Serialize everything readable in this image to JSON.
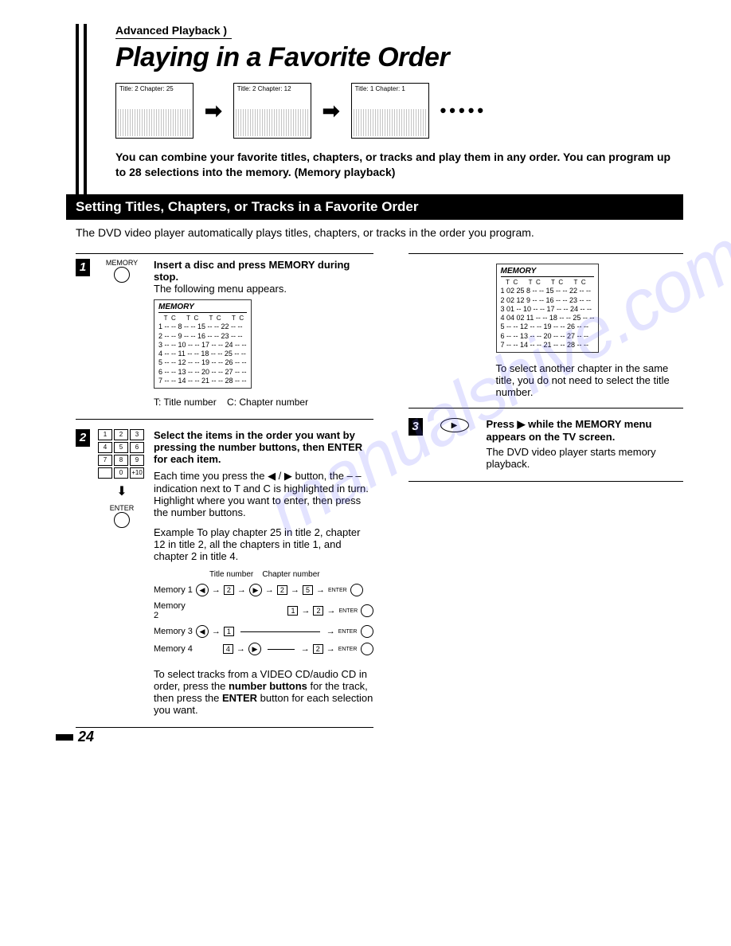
{
  "breadcrumb": "Advanced Playback",
  "title": "Playing in a Favorite Order",
  "cards": {
    "c1": "Title: 2\nChapter: 25",
    "c2": "Title: 2\nChapter: 12",
    "c3": "Title: 1\nChapter: 1"
  },
  "intro": "You can combine your favorite titles, chapters, or tracks and play them in any order. You can program up to 28 selections into the memory. (Memory playback)",
  "section_bar": "Setting Titles, Chapters, or Tracks in a Favorite Order",
  "subtext": "The DVD video player automatically plays titles, chapters, or tracks in the order you program.",
  "step1": {
    "icon_label": "MEMORY",
    "heading": "Insert a disc and press MEMORY during stop.",
    "sub": "The following menu appears.",
    "table_title": "MEMORY",
    "head": "T  C",
    "rows": [
      "1 -- --   8 -- --  15 -- --  22 -- --",
      "2 -- --   9 -- --  16 -- --  23 -- --",
      "3 -- --  10 -- --  17 -- --  24 -- --",
      "4 -- --  11 -- --  18 -- --  25 -- --",
      "5 -- --  12 -- --  19 -- --  26 -- --",
      "6 -- --  13 -- --  20 -- --  27 -- --",
      "7 -- --  14 -- --  21 -- --  28 -- --"
    ],
    "legend_t": "T: Title number",
    "legend_c": "C: Chapter number"
  },
  "step2": {
    "enter_label": "ENTER",
    "heading": "Select the items in the order you want by pressing the number buttons, then ENTER for each item.",
    "body1": "Each time you press the ◀ / ▶ button, the – – indication next to T and C is highlighted in turn. Highlight where you want to enter, then press the number buttons.",
    "example_label": "Example",
    "example_text": "To play chapter 25 in title 2, chapter 12 in title 2, all the chapters in title 1, and chapter 2 in title 4.",
    "col_title": "Title number",
    "col_chap": "Chapter number",
    "mem1": "Memory 1",
    "mem2": "Memory 2",
    "mem3": "Memory 3",
    "mem4": "Memory 4",
    "note": "To select tracks from a VIDEO CD/audio CD in order, press the number buttons for the track, then press the ENTER button for each selection you want."
  },
  "right": {
    "table_title": "MEMORY",
    "rows": [
      "1 02 25   8 -- --  15 -- --  22 -- --",
      "2 02 12   9 -- --  16 -- --  23 -- --",
      "3 01 --  10 -- --  17 -- --  24 -- --",
      "4 04 02  11 -- --  18 -- --  25 -- --",
      "5 -- --  12 -- --  19 -- --  26 -- --",
      "6 -- --  13 -- --  20 -- --  27 -- --",
      "7 -- --  14 -- --  21 -- --  28 -- --"
    ],
    "note": "To select another chapter in the same title, you do not need to select the title number."
  },
  "step3": {
    "heading": "Press ▶ while the MEMORY menu appears on the TV screen.",
    "body": "The DVD video player starts memory playback."
  },
  "page_number": "24",
  "watermark": "manualshive.com"
}
